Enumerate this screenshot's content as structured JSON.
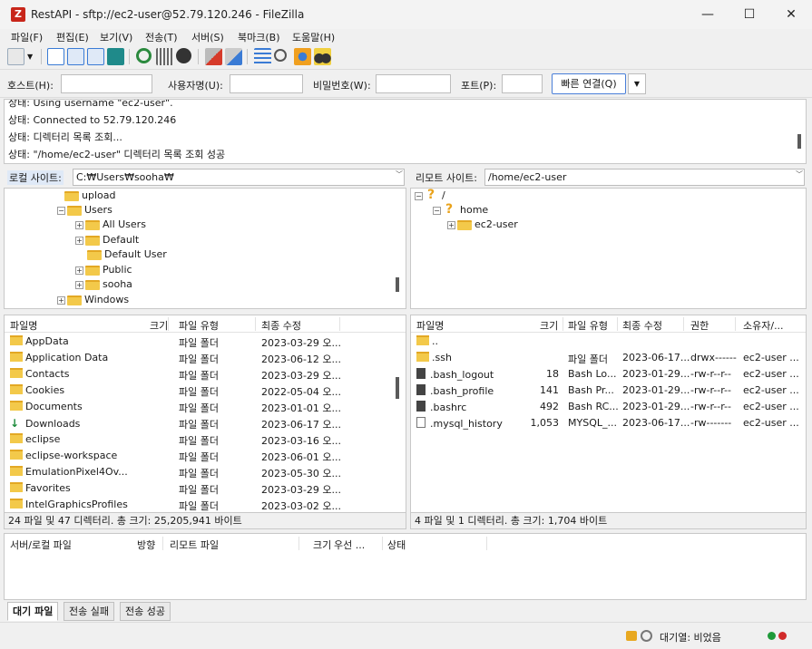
{
  "window": {
    "title": "RestAPI - sftp://ec2-user@52.79.120.246 - FileZilla",
    "app_icon": "Z",
    "minimize": "—",
    "maximize": "☐",
    "close": "✕"
  },
  "menu": [
    "파일(F)",
    "편집(E)",
    "보기(V)",
    "전송(T)",
    "서버(S)",
    "북마크(B)",
    "도움말(H)"
  ],
  "quickconnect": {
    "host_label": "호스트(H):",
    "host_value": "",
    "user_label": "사용자명(U):",
    "user_value": "",
    "pass_label": "비밀번호(W):",
    "pass_value": "",
    "port_label": "포트(P):",
    "port_value": "",
    "connect_button": "빠른 연결(Q)",
    "dropdown": "▼"
  },
  "log": [
    "상태:  Using username \"ec2-user\".",
    "상태:  Connected to 52.79.120.246",
    "상태:  디렉터리 목록 조회...",
    "상태:  \"/home/ec2-user\" 디렉터리 목록 조회 성공"
  ],
  "local": {
    "site_label": "로컬 사이트:",
    "path": "C:₩Users₩sooha₩",
    "tree": [
      "upload",
      "Users",
      "All Users",
      "Default",
      "Default User",
      "Public",
      "sooha",
      "Windows"
    ],
    "expander_plus": "+",
    "expander_minus": "−",
    "sort_arrow": "^",
    "headers": {
      "name": "파일명",
      "size": "크기",
      "type": "파일 유형",
      "modified": "최종 수정"
    },
    "files": [
      {
        "name": "AppData",
        "type": "파일 폴더",
        "modified": "2023-03-29 오..."
      },
      {
        "name": "Application Data",
        "type": "파일 폴더",
        "modified": "2023-06-12 오..."
      },
      {
        "name": "Contacts",
        "type": "파일 폴더",
        "modified": "2023-03-29 오..."
      },
      {
        "name": "Cookies",
        "type": "파일 폴더",
        "modified": "2022-05-04 오..."
      },
      {
        "name": "Documents",
        "type": "파일 폴더",
        "modified": "2023-01-01 오..."
      },
      {
        "name": "Downloads",
        "type": "파일 폴더",
        "modified": "2023-06-17 오..."
      },
      {
        "name": "eclipse",
        "type": "파일 폴더",
        "modified": "2023-03-16 오..."
      },
      {
        "name": "eclipse-workspace",
        "type": "파일 폴더",
        "modified": "2023-06-01 오..."
      },
      {
        "name": "EmulationPixel4Ov...",
        "type": "파일 폴더",
        "modified": "2023-05-30 오..."
      },
      {
        "name": "Favorites",
        "type": "파일 폴더",
        "modified": "2023-03-29 오..."
      },
      {
        "name": "IntelGraphicsProfiles",
        "type": "파일 폴더",
        "modified": "2023-03-02 오..."
      }
    ],
    "summary": "24 파일 및 47 디렉터리. 총 크기: 25,205,941 바이트"
  },
  "remote": {
    "site_label": "리모트 사이트:",
    "path": "/home/ec2-user",
    "tree": [
      "/",
      "home",
      "ec2-user"
    ],
    "qmark": "?",
    "headers": {
      "name": "파일명",
      "size": "크기",
      "type": "파일 유형",
      "modified": "최종 수정",
      "perms": "권한",
      "owner": "소유자/..."
    },
    "files": [
      {
        "name": "..",
        "size": "",
        "type": "",
        "modified": "",
        "perms": "",
        "owner": ""
      },
      {
        "name": ".ssh",
        "size": "",
        "type": "파일 폴더",
        "modified": "2023-06-17...",
        "perms": "drwx------",
        "owner": "ec2-user ..."
      },
      {
        "name": ".bash_logout",
        "size": "18",
        "type": "Bash Lo...",
        "modified": "2023-01-29...",
        "perms": "-rw-r--r--",
        "owner": "ec2-user ..."
      },
      {
        "name": ".bash_profile",
        "size": "141",
        "type": "Bash Pr...",
        "modified": "2023-01-29...",
        "perms": "-rw-r--r--",
        "owner": "ec2-user ..."
      },
      {
        "name": ".bashrc",
        "size": "492",
        "type": "Bash RC...",
        "modified": "2023-01-29...",
        "perms": "-rw-r--r--",
        "owner": "ec2-user ..."
      },
      {
        "name": ".mysql_history",
        "size": "1,053",
        "type": "MYSQL_...",
        "modified": "2023-06-17...",
        "perms": "-rw-------",
        "owner": "ec2-user ..."
      }
    ],
    "summary": "4 파일 및 1 디렉터리. 총 크기: 1,704 바이트"
  },
  "queue": {
    "headers": [
      "서버/로컬 파일",
      "방향",
      "리모트 파일",
      "크기",
      "우선 ...",
      "상태"
    ],
    "tabs": [
      "대기 파일",
      "전송 실패",
      "전송 성공"
    ]
  },
  "status": {
    "queue_text": "대기열: 비었음"
  },
  "colors": {
    "folder": "#f3c94a",
    "accent": "#4a7fd8",
    "app_icon_bg": "#c8261a"
  }
}
